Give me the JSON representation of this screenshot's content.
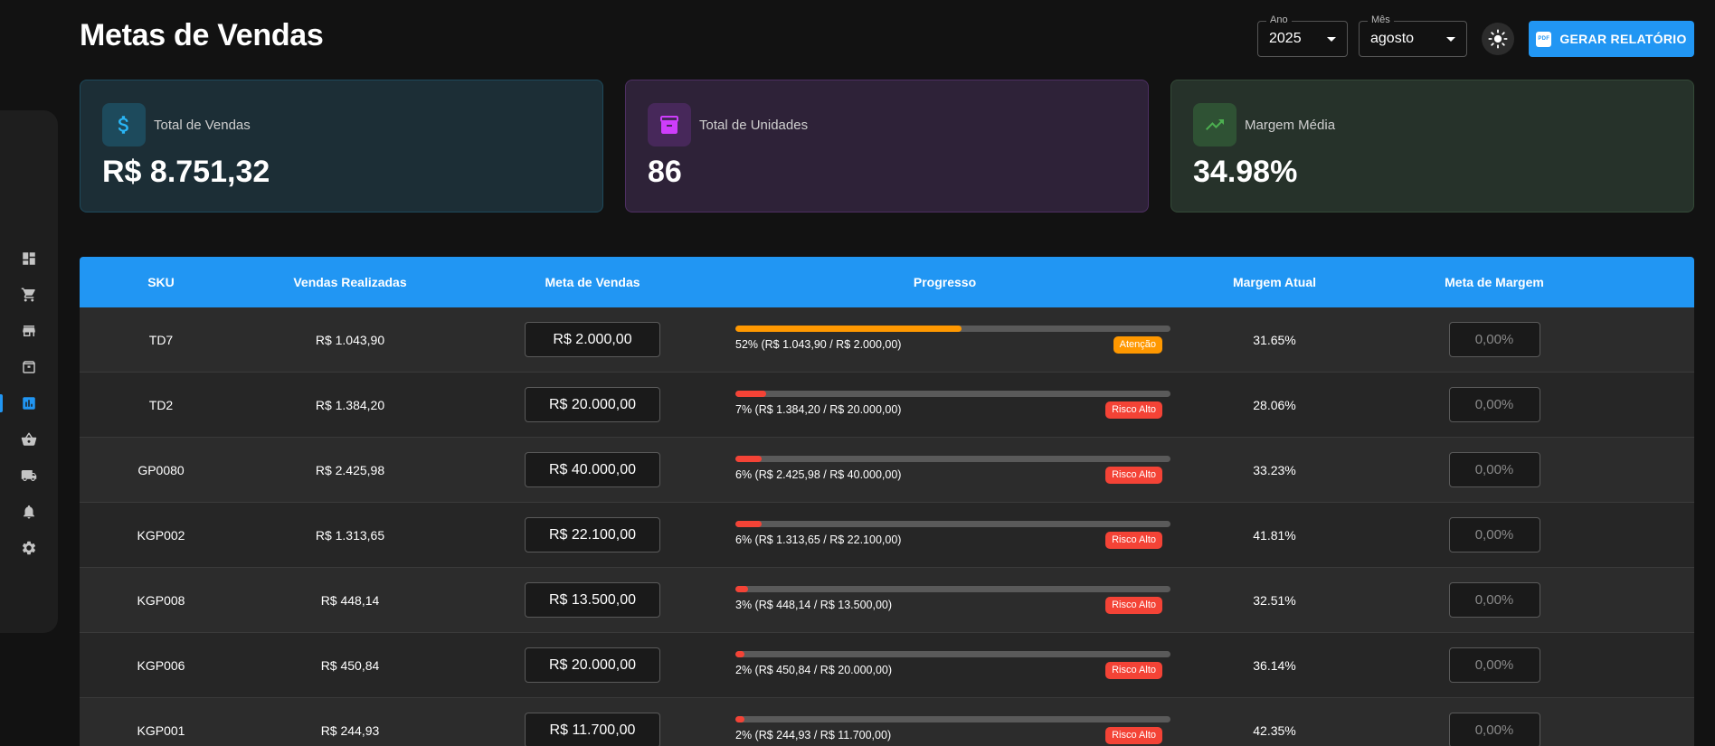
{
  "header": {
    "title": "Metas de Vendas",
    "year_label": "Ano",
    "year_value": "2025",
    "month_label": "Mês",
    "month_value": "agosto",
    "report_button": "GERAR RELATÓRIO",
    "report_icon_text": "PDF"
  },
  "sidebar": {
    "items": [
      {
        "icon": "dashboard-icon",
        "active": false
      },
      {
        "icon": "cart-icon",
        "active": false
      },
      {
        "icon": "store-icon",
        "active": false
      },
      {
        "icon": "archive-icon",
        "active": false
      },
      {
        "icon": "bar-chart-icon",
        "active": true
      },
      {
        "icon": "basket-icon",
        "active": false
      },
      {
        "icon": "truck-icon",
        "active": false
      },
      {
        "icon": "bell-icon",
        "active": false
      },
      {
        "icon": "gear-icon",
        "active": false
      }
    ]
  },
  "cards": [
    {
      "label": "Total de Vendas",
      "value": "R$ 8.751,32",
      "icon": "dollar-icon",
      "color": "#29b6f6"
    },
    {
      "label": "Total de Unidades",
      "value": "86",
      "icon": "archive-icon",
      "color": "#ce3dfb"
    },
    {
      "label": "Margem Média",
      "value": "34.98%",
      "icon": "trending-up-icon",
      "color": "#4caf50"
    }
  ],
  "table": {
    "headers": [
      "SKU",
      "Vendas Realizadas",
      "Meta de Vendas",
      "Progresso",
      "Margem Atual",
      "Meta de Margem"
    ],
    "rows": [
      {
        "sku": "TD7",
        "sales": "R$ 1.043,90",
        "goal": "R$ 2.000,00",
        "progress": 52,
        "progress_text": "52% (R$ 1.043,90 / R$ 2.000,00)",
        "status": "Atenção",
        "status_color": "#ff9800",
        "margin": "31.65%",
        "margin_goal": "0,00%"
      },
      {
        "sku": "TD2",
        "sales": "R$ 1.384,20",
        "goal": "R$ 20.000,00",
        "progress": 7,
        "progress_text": "7% (R$ 1.384,20 / R$ 20.000,00)",
        "status": "Risco Alto",
        "status_color": "#f44336",
        "margin": "28.06%",
        "margin_goal": "0,00%"
      },
      {
        "sku": "GP0080",
        "sales": "R$ 2.425,98",
        "goal": "R$ 40.000,00",
        "progress": 6,
        "progress_text": "6% (R$ 2.425,98 / R$ 40.000,00)",
        "status": "Risco Alto",
        "status_color": "#f44336",
        "margin": "33.23%",
        "margin_goal": "0,00%"
      },
      {
        "sku": "KGP002",
        "sales": "R$ 1.313,65",
        "goal": "R$ 22.100,00",
        "progress": 6,
        "progress_text": "6% (R$ 1.313,65 / R$ 22.100,00)",
        "status": "Risco Alto",
        "status_color": "#f44336",
        "margin": "41.81%",
        "margin_goal": "0,00%"
      },
      {
        "sku": "KGP008",
        "sales": "R$ 448,14",
        "goal": "R$ 13.500,00",
        "progress": 3,
        "progress_text": "3% (R$ 448,14 / R$ 13.500,00)",
        "status": "Risco Alto",
        "status_color": "#f44336",
        "margin": "32.51%",
        "margin_goal": "0,00%"
      },
      {
        "sku": "KGP006",
        "sales": "R$ 450,84",
        "goal": "R$ 20.000,00",
        "progress": 2,
        "progress_text": "2% (R$ 450,84 / R$ 20.000,00)",
        "status": "Risco Alto",
        "status_color": "#f44336",
        "margin": "36.14%",
        "margin_goal": "0,00%"
      },
      {
        "sku": "KGP001",
        "sales": "R$ 244,93",
        "goal": "R$ 11.700,00",
        "progress": 2,
        "progress_text": "2% (R$ 244,93 / R$ 11.700,00)",
        "status": "Risco Alto",
        "status_color": "#f44336",
        "margin": "42.35%",
        "margin_goal": "0,00%"
      }
    ]
  }
}
